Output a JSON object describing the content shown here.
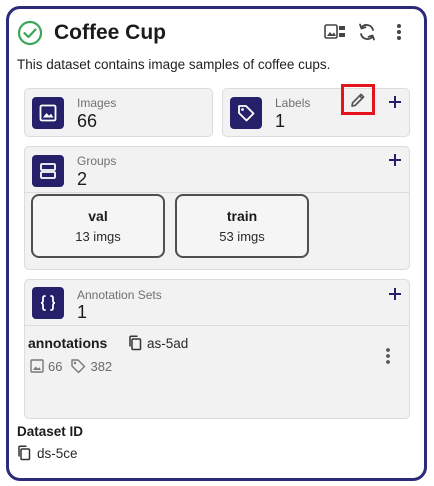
{
  "header": {
    "title": "Coffee Cup",
    "description": "This dataset contains image samples of coffee cups.",
    "status_icon": "check-circle-icon",
    "actions": [
      "image-preview-icon",
      "sync-icon",
      "more-vert-icon"
    ]
  },
  "images": {
    "label": "Images",
    "value": "66",
    "icon": "image-icon"
  },
  "labels": {
    "label": "Labels",
    "value": "1",
    "icon": "tag-icon"
  },
  "groups": {
    "label": "Groups",
    "value": "2",
    "icon": "groups-icon",
    "items": [
      {
        "name": "val",
        "count": "13 imgs"
      },
      {
        "name": "train",
        "count": "53 imgs"
      }
    ]
  },
  "annotation_sets": {
    "label": "Annotation Sets",
    "value": "1",
    "icon": "braces-icon",
    "items": [
      {
        "name": "annotations",
        "id": "as-5ad",
        "images": "66",
        "labels": "382"
      }
    ]
  },
  "dataset": {
    "id_label": "Dataset ID",
    "id": "ds-5ce"
  },
  "colors": {
    "accent": "#26206b",
    "border": "#2d2a7a",
    "check": "#3aa657",
    "highlight": "#e3141b"
  }
}
